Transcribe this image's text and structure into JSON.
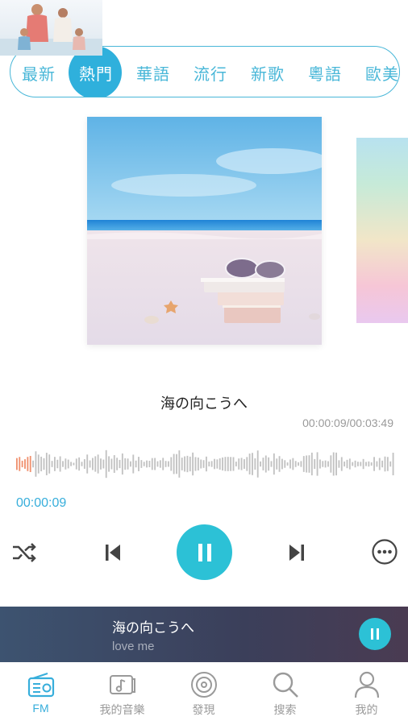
{
  "categories": [
    "最新",
    "熱門",
    "華語",
    "流行",
    "新歌",
    "粵語",
    "歐美"
  ],
  "active_category_index": 1,
  "song": {
    "title": "海の向こうへ",
    "time_display": "00:00:09/00:03:49",
    "current_time": "00:00:09",
    "progress": 0.04
  },
  "controls": {
    "shuffle_icon": "shuffle-icon",
    "prev_icon": "skip-previous-icon",
    "play_state_icon": "pause-icon",
    "next_icon": "skip-next-icon",
    "more_icon": "more-options-icon"
  },
  "mini_player": {
    "title": "海の向こうへ",
    "subtitle": "love me",
    "state_icon": "pause-icon"
  },
  "nav": [
    {
      "label": "FM",
      "icon": "radio-icon",
      "active": true
    },
    {
      "label": "我的音樂",
      "icon": "music-folder-icon",
      "active": false
    },
    {
      "label": "發現",
      "icon": "disc-icon",
      "active": false
    },
    {
      "label": "搜索",
      "icon": "search-icon",
      "active": false
    },
    {
      "label": "我的",
      "icon": "user-icon",
      "active": false
    }
  ],
  "colors": {
    "accent": "#2cc1d6",
    "accent_text": "#37aedb",
    "waveform_played": "#f0916f",
    "waveform_unplayed": "#c2c2c2"
  }
}
